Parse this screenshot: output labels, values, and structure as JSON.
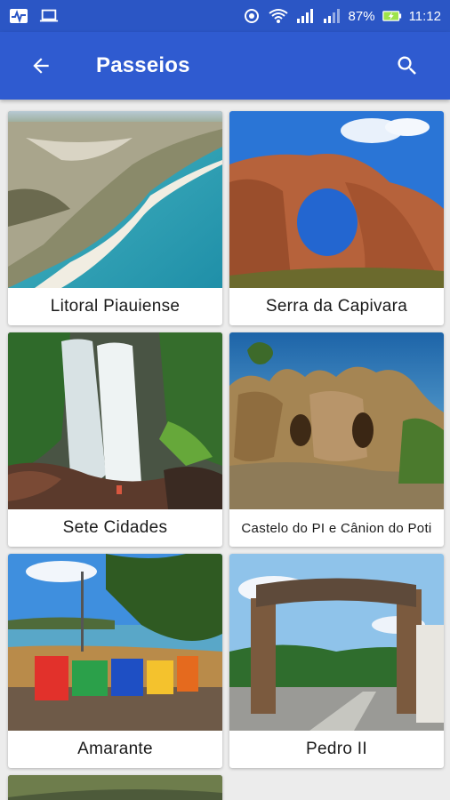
{
  "status_bar": {
    "battery": "87%",
    "time": "11:12",
    "icons": [
      "activity-icon",
      "laptop-icon",
      "vibrate-icon",
      "wifi-icon",
      "signal-icon",
      "signal-icon",
      "battery-charging-icon"
    ]
  },
  "app_bar": {
    "title": "Passeios",
    "back_icon": "arrow-left-icon",
    "search_icon": "search-icon",
    "color": "#2f5bd0"
  },
  "tours": [
    {
      "label": "Litoral Piauiense"
    },
    {
      "label": "Serra da Capivara"
    },
    {
      "label": "Sete Cidades"
    },
    {
      "label": "Castelo do PI e Cânion do Poti"
    },
    {
      "label": "Amarante"
    },
    {
      "label": "Pedro II"
    }
  ]
}
